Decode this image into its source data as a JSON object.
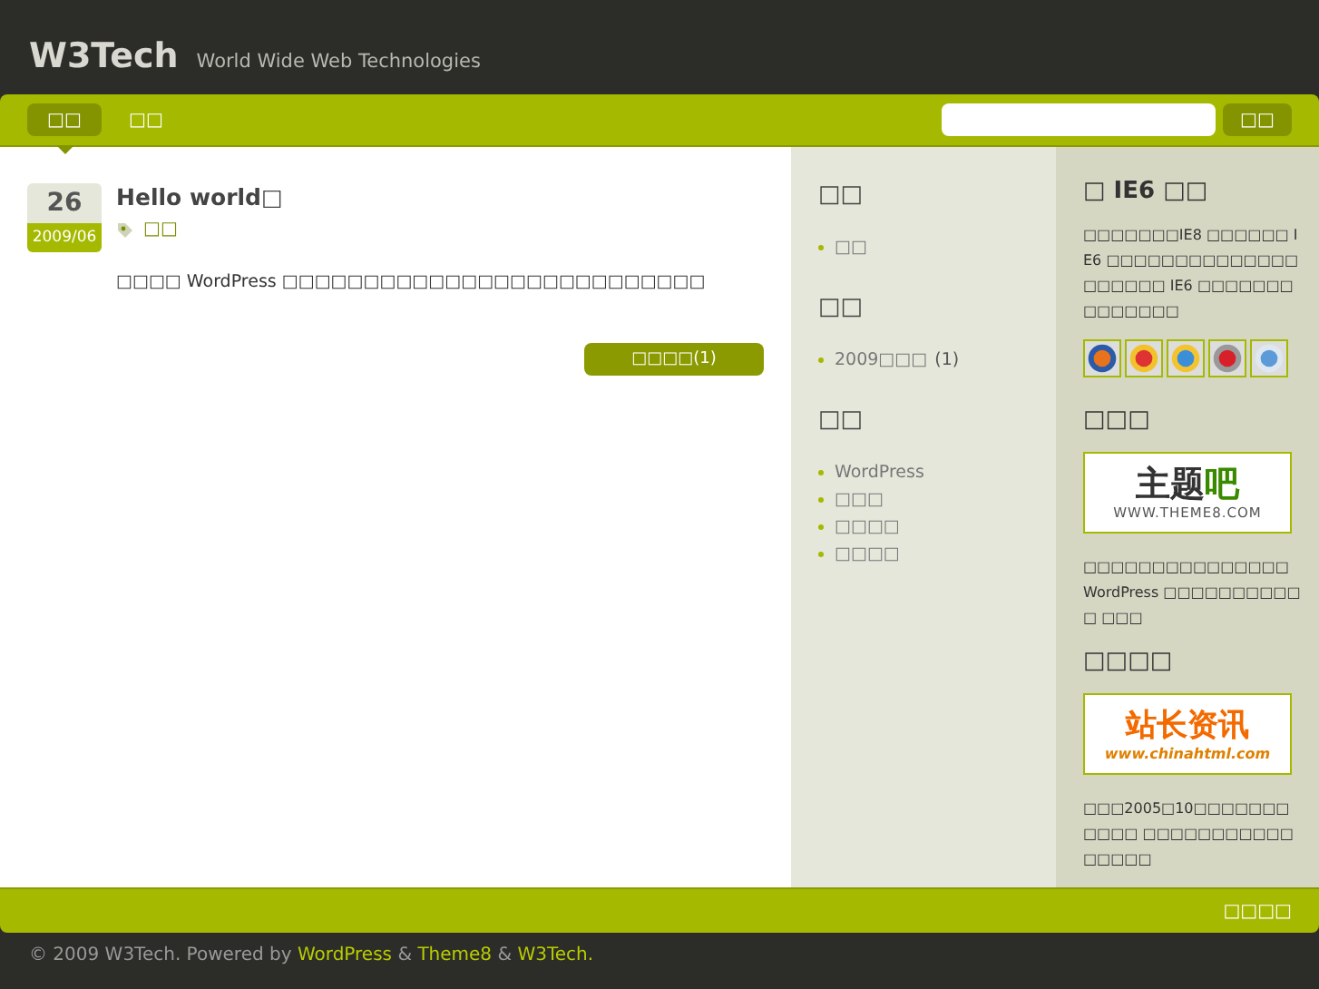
{
  "header": {
    "logo": "W3Tech",
    "tagline": "World Wide Web Technologies"
  },
  "nav": {
    "items": [
      {
        "label": "□□",
        "selected": true
      },
      {
        "label": "□□",
        "selected": false
      }
    ],
    "search_button": "□□"
  },
  "post": {
    "day": "26",
    "month": "2009/06",
    "title": "Hello world□",
    "tag": "□□",
    "body": "□□□□ WordPress □□□□□□□□□□□□□□□□□□□□□□□□□□",
    "comments_button": "□□□□(1)"
  },
  "sidebar": [
    {
      "title": "□□",
      "items": [
        {
          "text": "□□"
        }
      ]
    },
    {
      "title": "□□",
      "items": [
        {
          "text": "2009□□□",
          "count": "(1)"
        }
      ]
    },
    {
      "title": "□□",
      "items": [
        {
          "text": "WordPress"
        },
        {
          "text": "□□□"
        },
        {
          "text": "□□□□"
        },
        {
          "text": "□□□□"
        }
      ]
    }
  ],
  "aside": [
    {
      "kind": "browsers",
      "title": "□ IE6 □□",
      "text": "□□□□□□□IE8 □□□□□□ IE6 □□□□□□□□□□□□□□□□□□□□ IE6 □□□□□□□□□□□□□□"
    },
    {
      "kind": "theme8",
      "title": "□□□",
      "banner": [
        "主题",
        "吧",
        "WWW.THEME8.COM"
      ],
      "text": "□□□□□□□□□□□□□□□ WordPress □□□□□□□□□□□ □□□"
    },
    {
      "kind": "chinahtml",
      "title": "□□□□",
      "banner": [
        "站长资讯",
        "www.chinahtml.com"
      ],
      "text": "□□□2005□10□□□□□□□□□□□ □□□□□□□□□□□□□□□□"
    }
  ],
  "footer": {
    "right": "□□□□",
    "parts": [
      {
        "text": "© 2009 W3Tech. Powered by"
      },
      {
        "link": "WordPress"
      },
      {
        "text": "&"
      },
      {
        "link": "Theme8"
      },
      {
        "text": "&"
      },
      {
        "link": "W3Tech."
      }
    ]
  }
}
